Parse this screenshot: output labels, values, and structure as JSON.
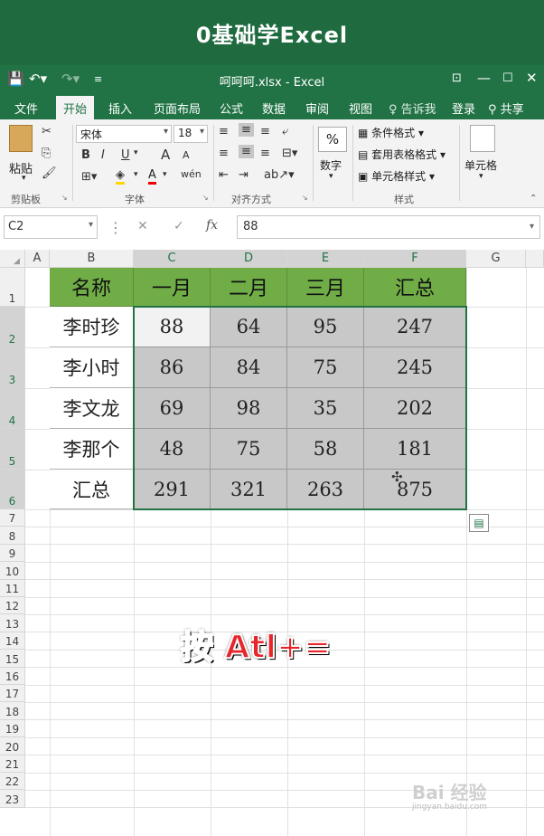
{
  "banner": {
    "title": "0基础学Excel"
  },
  "window": {
    "doc_title": "呵呵呵.xlsx - Excel",
    "save_icon": "save-icon",
    "undo_icon": "undo-icon",
    "redo_icon": "redo-icon"
  },
  "tabs": [
    {
      "label": "文件"
    },
    {
      "label": "开始"
    },
    {
      "label": "插入"
    },
    {
      "label": "页面布局"
    },
    {
      "label": "公式"
    },
    {
      "label": "数据"
    },
    {
      "label": "审阅"
    },
    {
      "label": "视图"
    }
  ],
  "tell_me": "告诉我",
  "login": "登录",
  "share": "共享",
  "ribbon": {
    "clipboard": {
      "paste": "粘贴",
      "group": "剪贴板"
    },
    "font": {
      "name": "宋体",
      "size": "18",
      "group": "字体",
      "bold": "B",
      "italic": "I",
      "underline": "U",
      "grow": "A",
      "shrink": "A",
      "font_color": "A",
      "phonetic": "wén"
    },
    "alignment": {
      "group": "对齐方式"
    },
    "number": {
      "label": "数字",
      "pct": "%"
    },
    "styles": {
      "cond": "条件格式",
      "table": "套用表格格式",
      "cell": "单元格样式",
      "group": "样式"
    },
    "cells": {
      "label": "单元格"
    }
  },
  "formula_bar": {
    "name_box": "C2",
    "fx": "fx",
    "value": "88",
    "cancel": "✕",
    "enter": "✓"
  },
  "columns": [
    "A",
    "B",
    "C",
    "D",
    "E",
    "F",
    "G"
  ],
  "rows": [
    "1",
    "2",
    "3",
    "4",
    "5",
    "6",
    "7",
    "8",
    "9",
    "10",
    "11",
    "12",
    "13",
    "14",
    "15",
    "16",
    "17",
    "18",
    "19",
    "20",
    "21",
    "22",
    "23"
  ],
  "table": {
    "header": [
      "名称",
      "一月",
      "二月",
      "三月",
      "汇总"
    ],
    "rows": [
      {
        "name": "李时珍",
        "values": [
          "88",
          "64",
          "95",
          "247"
        ]
      },
      {
        "name": "李小时",
        "values": [
          "86",
          "84",
          "75",
          "245"
        ]
      },
      {
        "name": "李文龙",
        "values": [
          "69",
          "98",
          "35",
          "202"
        ]
      },
      {
        "name": "李那个",
        "values": [
          "48",
          "75",
          "58",
          "181"
        ]
      },
      {
        "name": "汇总",
        "values": [
          "291",
          "321",
          "263",
          "875"
        ]
      }
    ]
  },
  "caption": {
    "key": "按",
    "shortcut": "Atl+="
  },
  "watermark": {
    "brand": "Bai 经验",
    "url": "jingyan.baidu.com"
  }
}
